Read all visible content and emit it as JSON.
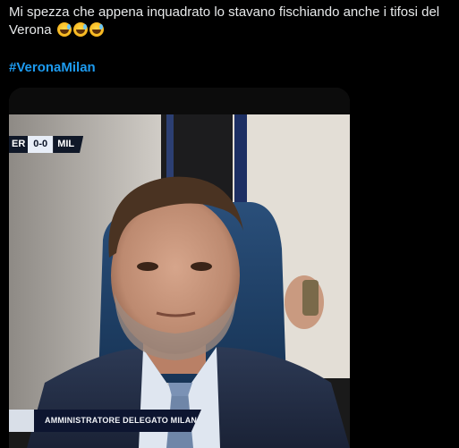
{
  "tweet": {
    "text": "Mi spezza che appena inquadrato lo stavano fischiando anche i tifosi del Verona",
    "emoji_icons": [
      "grinning-sweat-emoji",
      "grinning-sweat-emoji",
      "grinning-sweat-emoji"
    ],
    "hashtag": "#VeronaMilan"
  },
  "media": {
    "scorebug": {
      "home": "ER",
      "score": "0-0",
      "away": "MIL"
    },
    "lower_third": "AMMINISTRATORE DELEGATO MILAN"
  },
  "colors": {
    "background": "#000000",
    "text": "#e7e9ea",
    "hashtag": "#1d9bf0"
  }
}
